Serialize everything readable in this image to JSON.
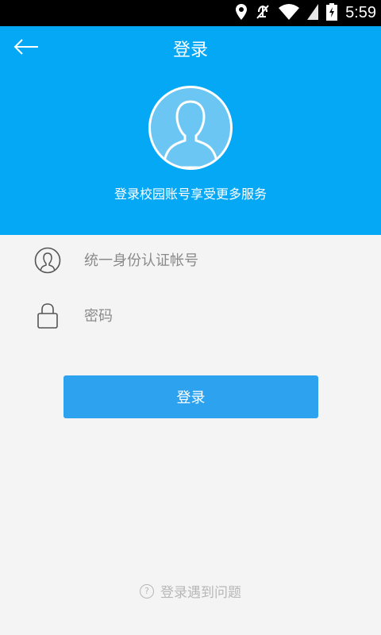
{
  "status_bar": {
    "time": "5:59",
    "icons": [
      "location-icon",
      "mute-icon",
      "wifi-icon",
      "signal-icon",
      "battery-charging-icon"
    ]
  },
  "header": {
    "title": "登录",
    "tagline": "登录校园账号享受更多服务",
    "back_icon": "arrow-left-icon",
    "avatar_icon": "user-silhouette-icon",
    "background_color": "#05a8f4"
  },
  "form": {
    "username": {
      "placeholder": "统一身份认证帐号",
      "value": "",
      "icon": "user-circle-icon"
    },
    "password": {
      "placeholder": "密码",
      "value": "",
      "icon": "lock-icon"
    }
  },
  "login_button": {
    "label": "登录",
    "color": "#2da3f0"
  },
  "help": {
    "label": "登录遇到问题",
    "icon": "question-circle-icon"
  }
}
